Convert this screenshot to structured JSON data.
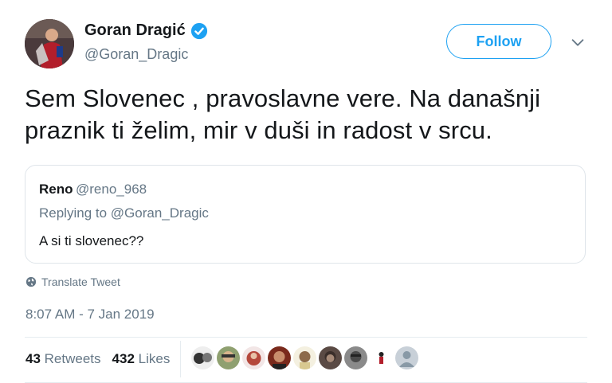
{
  "author": {
    "display_name": "Goran Dragić",
    "handle": "@Goran_Dragic",
    "avatar_icon": "user-photo"
  },
  "actions": {
    "follow_label": "Follow",
    "more_icon": "chevron-down-icon"
  },
  "tweet": {
    "text": "Sem Slovenec , pravoslavne vere. Na današnji praznik ti želim, mir v duši in radost v srcu."
  },
  "quoted": {
    "name": "Reno",
    "handle": "@reno_968",
    "replying_prefix": "Replying to",
    "replying_to": "@Goran_Dragic",
    "text": "A si ti slovenec??"
  },
  "translate_label": "Translate Tweet",
  "timestamp": "8:07 AM - 7 Jan 2019",
  "stats": {
    "retweets_count": "43",
    "retweets_label": "Retweets",
    "likes_count": "432",
    "likes_label": "Likes"
  },
  "colors": {
    "accent": "#1da1f2",
    "secondary_text": "#657786",
    "border": "#e6ecf0"
  }
}
